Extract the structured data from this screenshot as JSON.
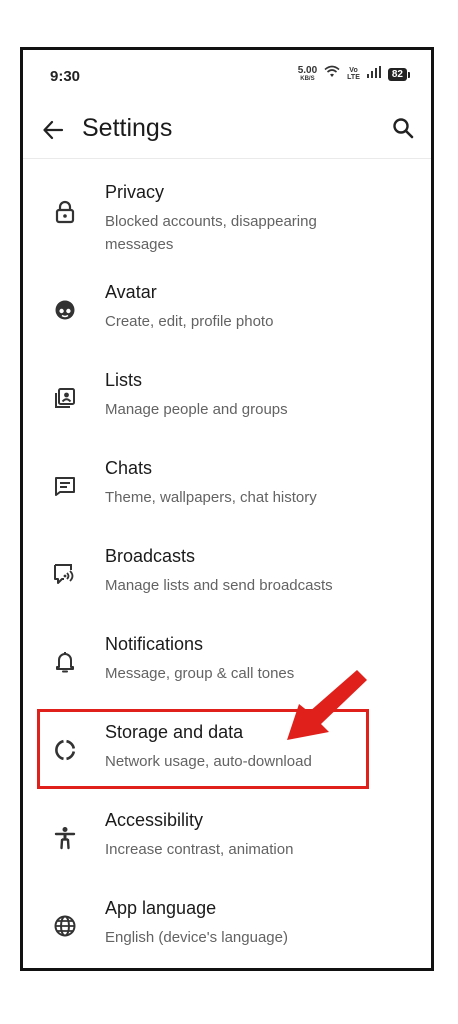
{
  "status_bar": {
    "time": "9:30",
    "net_speed_value": "5.00",
    "net_speed_unit": "KB/S",
    "volte_top": "Vo",
    "volte_bottom": "LTE",
    "battery": "82"
  },
  "app_bar": {
    "title": "Settings",
    "back_icon": "arrow-left-icon",
    "search_icon": "search-icon"
  },
  "items": [
    {
      "label": "Privacy",
      "sub": "Blocked accounts, disappearing messages",
      "icon": "lock-icon"
    },
    {
      "label": "Avatar",
      "sub": "Create, edit, profile photo",
      "icon": "avatar-face-icon"
    },
    {
      "label": "Lists",
      "sub": "Manage people and groups",
      "icon": "contacts-list-icon"
    },
    {
      "label": "Chats",
      "sub": "Theme, wallpapers, chat history",
      "icon": "chat-message-icon"
    },
    {
      "label": "Broadcasts",
      "sub": "Manage lists and send broadcasts",
      "icon": "broadcast-icon"
    },
    {
      "label": "Notifications",
      "sub": "Message, group & call tones",
      "icon": "bell-icon"
    },
    {
      "label": "Storage and data",
      "sub": "Network usage, auto-download",
      "icon": "storage-circle-icon"
    },
    {
      "label": "Accessibility",
      "sub": "Increase contrast, animation",
      "icon": "accessibility-person-icon"
    },
    {
      "label": "App language",
      "sub": "English (device's language)",
      "icon": "globe-icon"
    }
  ],
  "annotation": {
    "highlight_color": "#e0201b"
  }
}
